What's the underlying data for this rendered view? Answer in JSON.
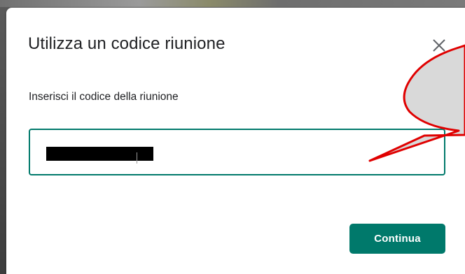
{
  "dialog": {
    "title": "Utilizza un codice riunione",
    "field_label": "Inserisci il codice della riunione",
    "code_value": "",
    "continue_label": "Continua",
    "close_icon": "close-icon"
  },
  "colors": {
    "accent": "#00796b",
    "annotation_red": "#e00000",
    "callout_fill": "#d9d9d9"
  }
}
